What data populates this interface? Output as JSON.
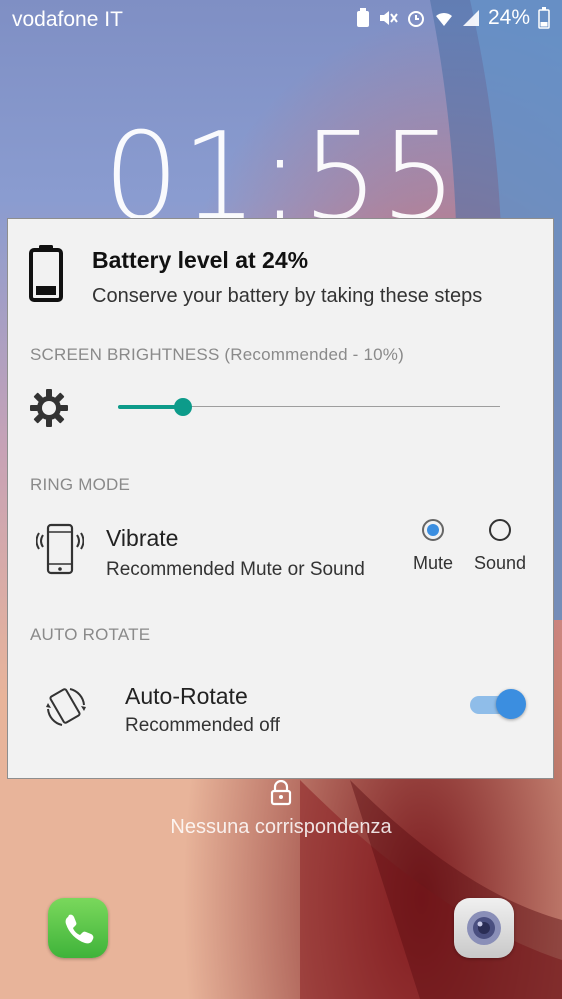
{
  "status_bar": {
    "carrier": "vodafone IT",
    "battery_percent": "24%"
  },
  "lockscreen": {
    "clock": "01:55",
    "unlock_message": "Nessuna corrispondenza"
  },
  "dialog": {
    "title": "Battery level at 24%",
    "subtitle": "Conserve your battery by taking these steps",
    "brightness": {
      "label": "SCREEN BRIGHTNESS (Recommended - 10%)",
      "level": 0.17
    },
    "ring_mode": {
      "label": "RING MODE",
      "current": "Vibrate",
      "recommendation": "Recommended Mute or Sound",
      "options": [
        {
          "label": "Mute",
          "selected": true
        },
        {
          "label": "Sound",
          "selected": false
        }
      ]
    },
    "auto_rotate": {
      "label": "AUTO ROTATE",
      "title": "Auto-Rotate",
      "recommendation": "Recommended off",
      "enabled": true
    }
  },
  "colors": {
    "accent_teal": "#0d9b8a",
    "accent_blue": "#3b8ee0"
  },
  "icons": [
    "battery-icon",
    "brightness-icon",
    "vibrate-phone-icon",
    "auto-rotate-icon",
    "lock-icon",
    "phone-icon",
    "camera-icon"
  ]
}
